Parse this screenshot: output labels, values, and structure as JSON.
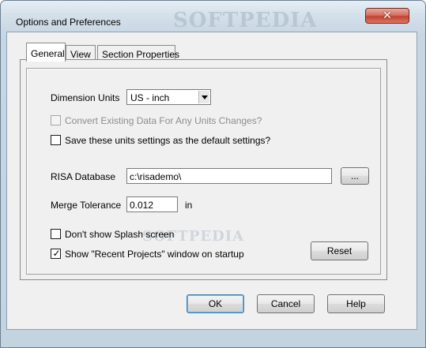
{
  "window": {
    "title": "Options and Preferences",
    "watermark": "SOFTPEDIA",
    "close_label": "✕"
  },
  "tabs": [
    {
      "label": "General"
    },
    {
      "label": "View"
    },
    {
      "label": "Section Properties"
    }
  ],
  "general": {
    "dimension_units_label": "Dimension Units",
    "dimension_units_value": "US - inch",
    "convert_existing_label": "Convert Existing Data For Any Units Changes?",
    "convert_existing_checked": false,
    "save_units_label": "Save these units settings as the default settings?",
    "save_units_checked": false,
    "risa_db_label": "RISA Database",
    "risa_db_value": "c:\\risademo\\",
    "browse_label": "...",
    "merge_tol_label": "Merge Tolerance",
    "merge_tol_value": "0.012",
    "merge_tol_unit": "in",
    "splash_label": "Don't show Splash screen",
    "splash_checked": false,
    "recent_label": "Show \"Recent Projects\" window on startup",
    "recent_checked": true,
    "reset_label": "Reset",
    "watermark2": "SOFTPEDIA"
  },
  "footer": {
    "ok_label": "OK",
    "cancel_label": "Cancel",
    "help_label": "Help"
  },
  "colors": {
    "close_button": "#c4412d",
    "title_bar": "#d3dfe9",
    "dialog_face": "#f0f0f0"
  }
}
